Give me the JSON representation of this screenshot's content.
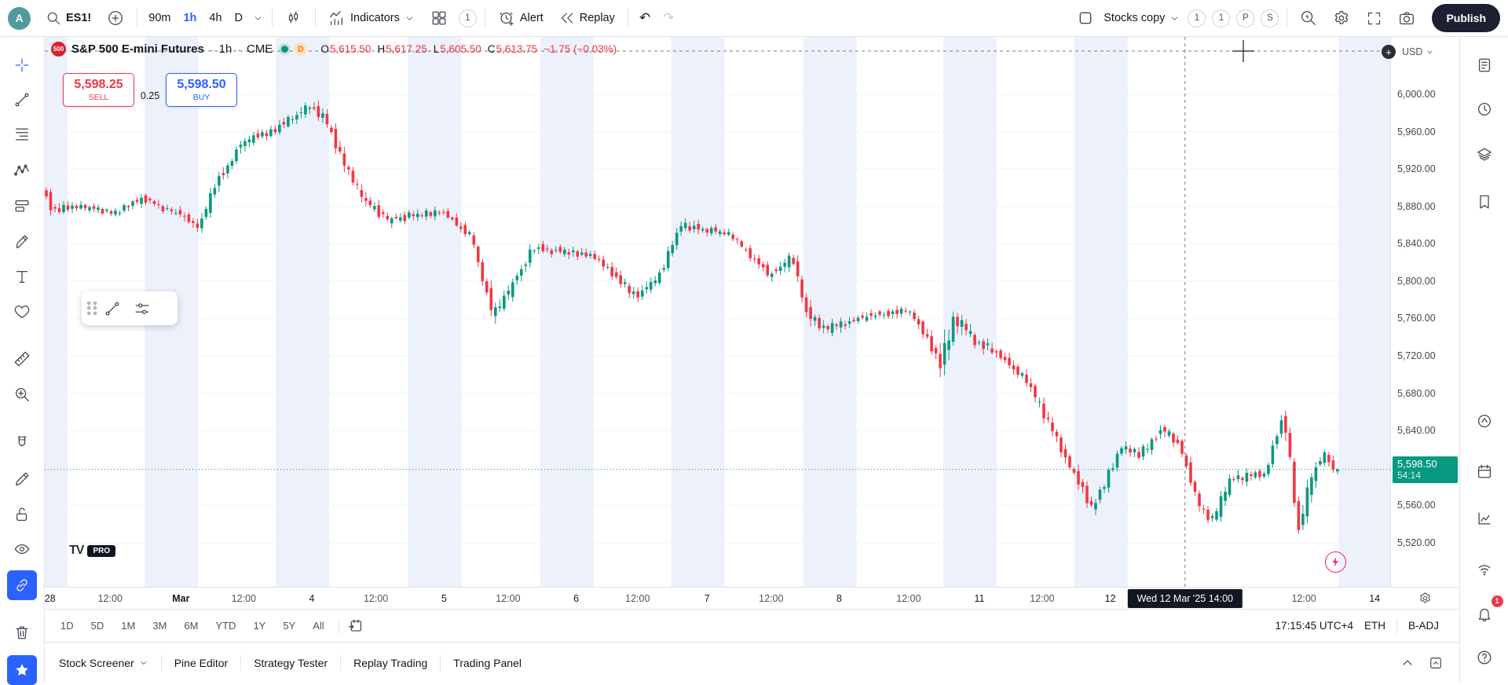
{
  "topbar": {
    "avatar_initial": "A",
    "symbol": "ES1!",
    "timeframes": [
      {
        "label": "90m",
        "active": false
      },
      {
        "label": "1h",
        "active": true
      },
      {
        "label": "4h",
        "active": false
      },
      {
        "label": "D",
        "active": false
      }
    ],
    "indicators_label": "Indicators",
    "layout_count": "1",
    "alert_label": "Alert",
    "replay_label": "Replay",
    "undo_glyph": "↶",
    "redo_glyph": "↷",
    "layout_name": "Stocks copy",
    "collab_badges": [
      "1",
      "1",
      "P",
      "S"
    ],
    "publish_label": "Publish"
  },
  "legend": {
    "logo_text": "500",
    "title": "S&P 500 E-mini Futures",
    "separator": "·",
    "interval": "1h",
    "exchange": "CME",
    "delayed_badge": "D",
    "ohlc": {
      "o_label": "O",
      "o": "5,615.50",
      "h_label": "H",
      "h": "5,617.25",
      "l_label": "L",
      "l": "5,605.50",
      "c_label": "C",
      "c": "5,613.75",
      "change": "−1.75 (−0.03%)"
    }
  },
  "order_panel": {
    "sell_price": "5,598.25",
    "sell_label": "SELL",
    "spread": "0.25",
    "buy_price": "5,598.50",
    "buy_label": "BUY"
  },
  "watermark": {
    "logo": "TV",
    "pro": "PRO"
  },
  "price_axis": {
    "currency": "USD",
    "labels": [
      {
        "p": 6000,
        "t": "6,000.00"
      },
      {
        "p": 5960,
        "t": "5,960.00"
      },
      {
        "p": 5920,
        "t": "5,920.00"
      },
      {
        "p": 5880,
        "t": "5,880.00"
      },
      {
        "p": 5840,
        "t": "5,840.00"
      },
      {
        "p": 5800,
        "t": "5,800.00"
      },
      {
        "p": 5760,
        "t": "5,760.00"
      },
      {
        "p": 5720,
        "t": "5,720.00"
      },
      {
        "p": 5680,
        "t": "5,680.00"
      },
      {
        "p": 5640,
        "t": "5,640.00"
      },
      {
        "p": 5560,
        "t": "5,560.00"
      },
      {
        "p": 5520,
        "t": "5,520.00"
      }
    ],
    "last_price": {
      "t": "5,598.50",
      "countdown": "54:14",
      "p": 5598.5
    }
  },
  "time_axis": {
    "ticks": [
      {
        "f": 0.004,
        "label": "28",
        "day": true
      },
      {
        "f": 0.049,
        "label": "12:00"
      },
      {
        "f": 0.102,
        "label": "Mar",
        "day": true,
        "strong": true
      },
      {
        "f": 0.149,
        "label": "12:00"
      },
      {
        "f": 0.2,
        "label": "4",
        "day": true
      },
      {
        "f": 0.248,
        "label": "12:00"
      },
      {
        "f": 0.299,
        "label": "5",
        "day": true
      },
      {
        "f": 0.347,
        "label": "12:00"
      },
      {
        "f": 0.398,
        "label": "6",
        "day": true
      },
      {
        "f": 0.444,
        "label": "12:00"
      },
      {
        "f": 0.496,
        "label": "7",
        "day": true
      },
      {
        "f": 0.544,
        "label": "12:00"
      },
      {
        "f": 0.595,
        "label": "8",
        "day": true
      },
      {
        "f": 0.647,
        "label": "12:00"
      },
      {
        "f": 0.7,
        "label": "11",
        "day": true
      },
      {
        "f": 0.747,
        "label": "12:00"
      },
      {
        "f": 0.798,
        "label": "12",
        "day": true
      },
      {
        "f": 0.943,
        "label": "12:00"
      },
      {
        "f": 0.996,
        "label": "14",
        "day": true
      }
    ],
    "tooltip": {
      "label": "Wed 12 Mar '25  14:00",
      "f": 0.854
    }
  },
  "range_row": {
    "ranges": [
      "1D",
      "5D",
      "1M",
      "3M",
      "6M",
      "YTD",
      "1Y",
      "5Y",
      "All"
    ],
    "clock": "17:15:45 UTC+4",
    "session": "ETH",
    "adjustment": "B-ADJ"
  },
  "bottom_bar": {
    "tabs": [
      {
        "label": "Stock Screener",
        "chevron": true
      },
      {
        "label": "Pine Editor"
      },
      {
        "label": "Strategy Tester"
      },
      {
        "label": "Replay Trading"
      },
      {
        "label": "Trading Panel"
      }
    ]
  },
  "left_rail": {
    "icons": [
      "crosshair-icon",
      "trend-line-icon",
      "fib-retracement-icon",
      "xabcd-pattern-icon",
      "long-position-icon",
      "brush-icon",
      "text-icon",
      "emoji-icon",
      "ruler-icon",
      "zoom-in-icon",
      "magnet-icon",
      "pencil-icon",
      "lock-icon",
      "eye-icon",
      "sync-drawings-icon",
      "trash-icon",
      "favorites-star-icon"
    ],
    "active": "sync-drawings-icon"
  },
  "right_rail": {
    "icons": [
      {
        "name": "watchlist-icon"
      },
      {
        "name": "alerts-clock-icon"
      },
      {
        "name": "object-tree-icon"
      },
      {
        "name": "data-window-icon"
      },
      {
        "name": "hotlists-icon"
      },
      {
        "name": "calendar-icon"
      },
      {
        "name": "ideas-icon"
      },
      {
        "name": "broadcast-icon"
      },
      {
        "name": "notifications-icon",
        "badge": "1"
      },
      {
        "name": "help-icon"
      }
    ]
  },
  "colors": {
    "up": "#089981",
    "down": "#f23645",
    "accent": "#2962ff",
    "sell": "#f23645",
    "buy": "#2962ff",
    "band": "#edf1fb",
    "grid_h": "#f2f3f7",
    "grid_v": "#eceff7",
    "crosshair": "#787b86",
    "last_price_bg": "#089981",
    "tooltip_bg": "#131722"
  },
  "chart_data": {
    "type": "candlestick",
    "symbol": "ES1!",
    "title": "S&P 500 E-mini Futures",
    "interval": "1h",
    "exchange": "CME",
    "visible_price_range": [
      5520,
      6000
    ],
    "visible_time_range": [
      "Feb 28",
      "Mar 14"
    ],
    "last_close": 5598.5,
    "ohlc_at_cursor": {
      "open": 5615.5,
      "high": 5617.25,
      "low": 5605.5,
      "close": 5613.75,
      "change": -1.75,
      "change_pct": -0.03
    },
    "candle_count": 300,
    "last_candle_fraction": 0.967,
    "crosshair_fraction": 0.854,
    "crosshair_time": "Wed 12 Mar '25 14:00",
    "session_band_offsets": [
      -0.027,
      0.013
    ],
    "price_path_anchors": [
      [
        0.0,
        5902,
        10
      ],
      [
        0.008,
        5876,
        8
      ],
      [
        0.03,
        5880,
        6
      ],
      [
        0.055,
        5872,
        6
      ],
      [
        0.075,
        5890,
        7
      ],
      [
        0.09,
        5878,
        6
      ],
      [
        0.105,
        5872,
        8
      ],
      [
        0.118,
        5856,
        9
      ],
      [
        0.128,
        5900,
        12
      ],
      [
        0.15,
        5948,
        10
      ],
      [
        0.168,
        5958,
        8
      ],
      [
        0.185,
        5972,
        8
      ],
      [
        0.2,
        5986,
        9
      ],
      [
        0.212,
        5974,
        8
      ],
      [
        0.225,
        5928,
        12
      ],
      [
        0.24,
        5888,
        10
      ],
      [
        0.258,
        5866,
        8
      ],
      [
        0.3,
        5874,
        6
      ],
      [
        0.322,
        5846,
        8
      ],
      [
        0.338,
        5760,
        14
      ],
      [
        0.352,
        5796,
        10
      ],
      [
        0.368,
        5836,
        8
      ],
      [
        0.415,
        5826,
        7
      ],
      [
        0.445,
        5784,
        9
      ],
      [
        0.462,
        5806,
        8
      ],
      [
        0.478,
        5860,
        8
      ],
      [
        0.515,
        5850,
        6
      ],
      [
        0.545,
        5806,
        8
      ],
      [
        0.562,
        5826,
        10
      ],
      [
        0.572,
        5766,
        12
      ],
      [
        0.588,
        5748,
        9
      ],
      [
        0.615,
        5762,
        7
      ],
      [
        0.648,
        5768,
        7
      ],
      [
        0.662,
        5744,
        9
      ],
      [
        0.672,
        5706,
        22
      ],
      [
        0.683,
        5766,
        18
      ],
      [
        0.695,
        5740,
        10
      ],
      [
        0.715,
        5722,
        8
      ],
      [
        0.737,
        5694,
        9
      ],
      [
        0.755,
        5644,
        10
      ],
      [
        0.77,
        5602,
        10
      ],
      [
        0.786,
        5556,
        12
      ],
      [
        0.797,
        5588,
        10
      ],
      [
        0.808,
        5624,
        9
      ],
      [
        0.822,
        5614,
        8
      ],
      [
        0.838,
        5642,
        9
      ],
      [
        0.852,
        5626,
        8
      ],
      [
        0.866,
        5560,
        11
      ],
      [
        0.877,
        5544,
        10
      ],
      [
        0.89,
        5588,
        9
      ],
      [
        0.916,
        5594,
        7
      ],
      [
        0.93,
        5660,
        14
      ],
      [
        0.941,
        5530,
        16
      ],
      [
        0.952,
        5598,
        10
      ],
      [
        0.962,
        5616,
        8
      ],
      [
        0.973,
        5572,
        9
      ],
      [
        0.983,
        5562,
        8
      ],
      [
        1.0,
        5598.5,
        7
      ]
    ]
  }
}
